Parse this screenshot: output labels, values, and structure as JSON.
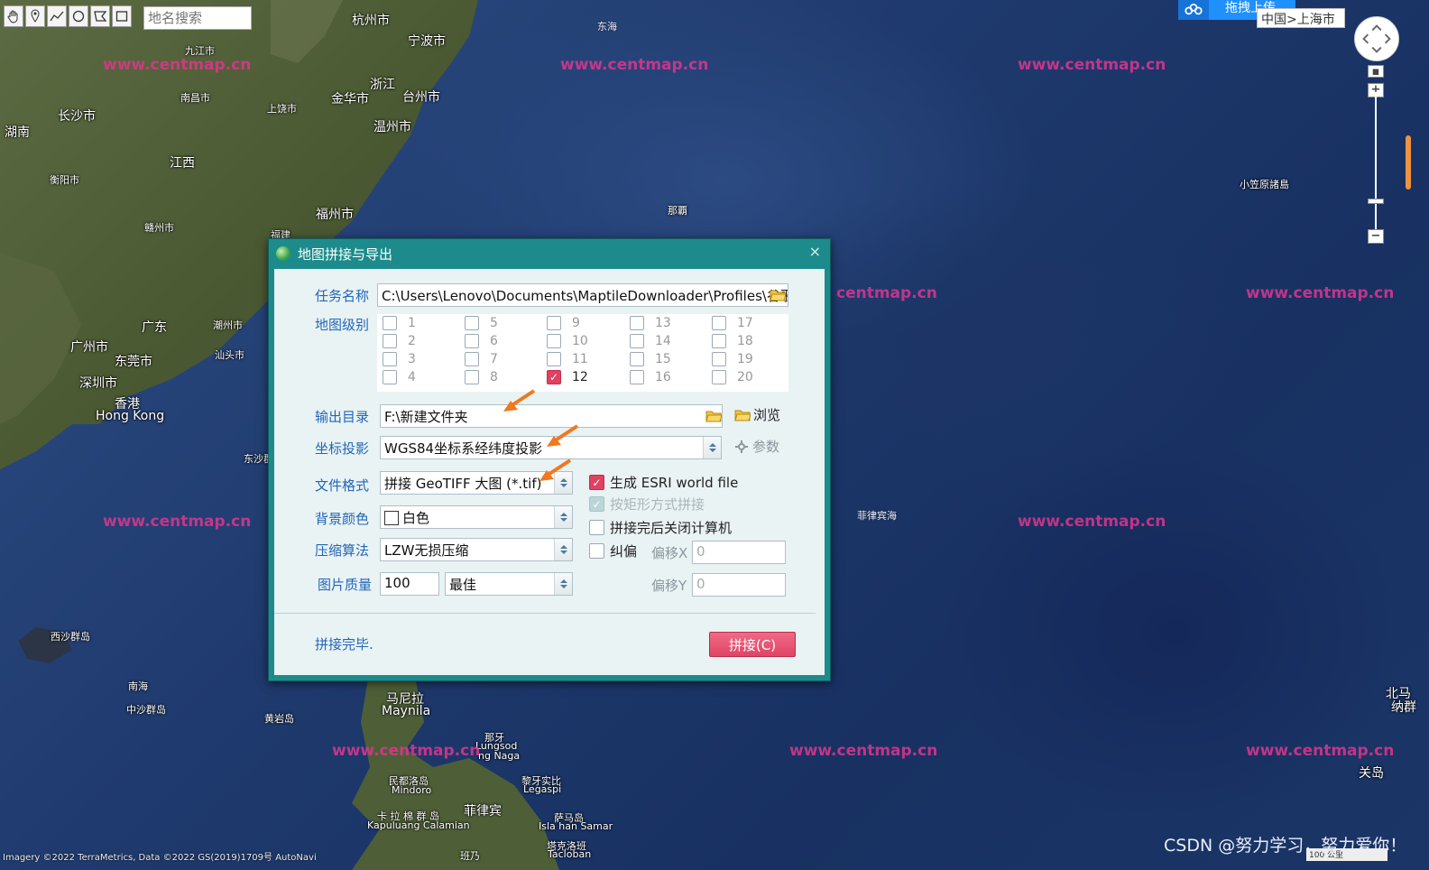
{
  "map": {
    "places": [
      {
        "name": "杭州市",
        "size": "normal"
      },
      {
        "name": "宁波市",
        "size": "normal"
      },
      {
        "name": "九江市",
        "size": "small"
      },
      {
        "name": "浙江",
        "size": "normal"
      },
      {
        "name": "南昌市",
        "size": "small"
      },
      {
        "name": "金华市",
        "size": "normal"
      },
      {
        "name": "台州市",
        "size": "normal"
      },
      {
        "name": "长沙市",
        "size": "normal"
      },
      {
        "name": "上饶市",
        "size": "small"
      },
      {
        "name": "温州市",
        "size": "normal"
      },
      {
        "name": "湖南",
        "size": "normal"
      },
      {
        "name": "衡阳市",
        "size": "small"
      },
      {
        "name": "江西",
        "size": "normal"
      },
      {
        "name": "赣州市",
        "size": "small"
      },
      {
        "name": "福州市",
        "size": "normal"
      },
      {
        "name": "福建",
        "size": "normal"
      },
      {
        "name": "广东",
        "size": "normal"
      },
      {
        "name": "潮州市",
        "size": "small"
      },
      {
        "name": "广州市",
        "size": "normal"
      },
      {
        "name": "东莞市",
        "size": "normal"
      },
      {
        "name": "汕头市",
        "size": "small"
      },
      {
        "name": "深圳市",
        "size": "normal"
      },
      {
        "name": "香港",
        "size": "normal"
      },
      {
        "name": "Hong Kong",
        "size": "normal"
      },
      {
        "name": "东沙群",
        "size": "small"
      },
      {
        "name": "西沙群岛",
        "size": "small"
      },
      {
        "name": "南海",
        "size": "small"
      },
      {
        "name": "中沙群岛",
        "size": "small"
      },
      {
        "name": "黄岩岛",
        "size": "small"
      },
      {
        "name": "马尼拉",
        "size": "normal"
      },
      {
        "name": "Maynila",
        "size": "normal"
      },
      {
        "name": "那覇",
        "size": "small"
      },
      {
        "name": "菲律宾海",
        "size": "small"
      },
      {
        "name": "小笠原諸島",
        "size": "small"
      },
      {
        "name": "东海",
        "size": "small"
      },
      {
        "name": "北马",
        "size": "normal"
      },
      {
        "name": "纳群",
        "size": "normal"
      },
      {
        "name": "关岛",
        "size": "normal"
      },
      {
        "name": "民都洛岛",
        "size": "small"
      },
      {
        "name": "Mindoro",
        "size": "small"
      },
      {
        "name": "菲律宾",
        "size": "normal"
      },
      {
        "name": "卡 拉 棉 群 岛",
        "size": "small"
      },
      {
        "name": "Kapuluang Calamian",
        "size": "small"
      },
      {
        "name": "黎牙实比",
        "size": "small"
      },
      {
        "name": "Legaspi",
        "size": "small"
      },
      {
        "name": "萨马岛",
        "size": "small"
      },
      {
        "name": "Isla han Samar",
        "size": "small"
      },
      {
        "name": "塔克洛班",
        "size": "small"
      },
      {
        "name": "Tacloban",
        "size": "small"
      },
      {
        "name": "班乃",
        "size": "small"
      },
      {
        "name": "那牙",
        "size": "small"
      },
      {
        "name": "Lungsod",
        "size": "small"
      },
      {
        "name": "ng Naga",
        "size": "small"
      }
    ],
    "watermark": "www.centmap.cn",
    "watermark_partial": "centmap.cn",
    "attribution": "Imagery ©2022 TerraMetrics, Data ©2022 GS(2019)1709号 AutoNavi",
    "csdn_watermark": "CSDN @努力学习，努力爱你！",
    "scale": "100 公里"
  },
  "toolbar": {
    "tools": [
      "hand-icon",
      "marker-icon",
      "polyline-icon",
      "circle-icon",
      "polygon-icon",
      "rectangle-icon"
    ],
    "search_placeholder": "地名搜索"
  },
  "top_right": {
    "upload_label": "拖拽上传",
    "breadcrumb": "中国>上海市",
    "zoom_in": "+",
    "zoom_out": "−"
  },
  "dialog": {
    "title": "地图拼接与导出",
    "close": "×",
    "task_name_label": "任务名称",
    "task_name_value": "C:\\Users\\Lenovo\\Documents\\MaptileDownloader\\Profiles\\谷歌混",
    "levels_label": "地图级别",
    "levels": [
      {
        "n": "1",
        "checked": false
      },
      {
        "n": "2",
        "checked": false
      },
      {
        "n": "3",
        "checked": false
      },
      {
        "n": "4",
        "checked": false
      },
      {
        "n": "5",
        "checked": false
      },
      {
        "n": "6",
        "checked": false
      },
      {
        "n": "7",
        "checked": false
      },
      {
        "n": "8",
        "checked": false
      },
      {
        "n": "9",
        "checked": false
      },
      {
        "n": "10",
        "checked": false
      },
      {
        "n": "11",
        "checked": false
      },
      {
        "n": "12",
        "checked": true
      },
      {
        "n": "13",
        "checked": false
      },
      {
        "n": "14",
        "checked": false
      },
      {
        "n": "15",
        "checked": false
      },
      {
        "n": "16",
        "checked": false
      },
      {
        "n": "17",
        "checked": false
      },
      {
        "n": "18",
        "checked": false
      },
      {
        "n": "19",
        "checked": false
      },
      {
        "n": "20",
        "checked": false
      }
    ],
    "output_dir_label": "输出目录",
    "output_dir_value": "F:\\新建文件夹",
    "browse_label": "浏览",
    "projection_label": "坐标投影",
    "projection_value": "WGS84坐标系经纬度投影",
    "params_label": "参数",
    "format_label": "文件格式",
    "format_value": "拼接 GeoTIFF 大图 (*.tif)",
    "bg_color_label": "背景颜色",
    "bg_color_value": "白色",
    "compression_label": "压缩算法",
    "compression_value": "LZW无损压缩",
    "quality_label": "图片质量",
    "quality_value": "100",
    "quality_preset": "最佳",
    "esri_label": "生成 ESRI world file",
    "esri_checked": true,
    "rect_label": "按矩形方式拼接",
    "rect_checked": true,
    "shutdown_label": "拼接完后关闭计算机",
    "shutdown_checked": false,
    "correct_label": "纠偏",
    "correct_checked": false,
    "offset_x_label": "偏移X",
    "offset_x_value": "0",
    "offset_y_label": "偏移Y",
    "offset_y_value": "0",
    "status": "拼接完毕.",
    "stitch_button": "拼接(C)"
  },
  "colors": {
    "dialog_frame": "#1d8b8b",
    "dialog_body": "#e9f3f4",
    "label_blue": "#2366b8",
    "stitch_button": "#e04466",
    "watermark": "#e0358f",
    "annotation_arrow": "#f07820"
  }
}
